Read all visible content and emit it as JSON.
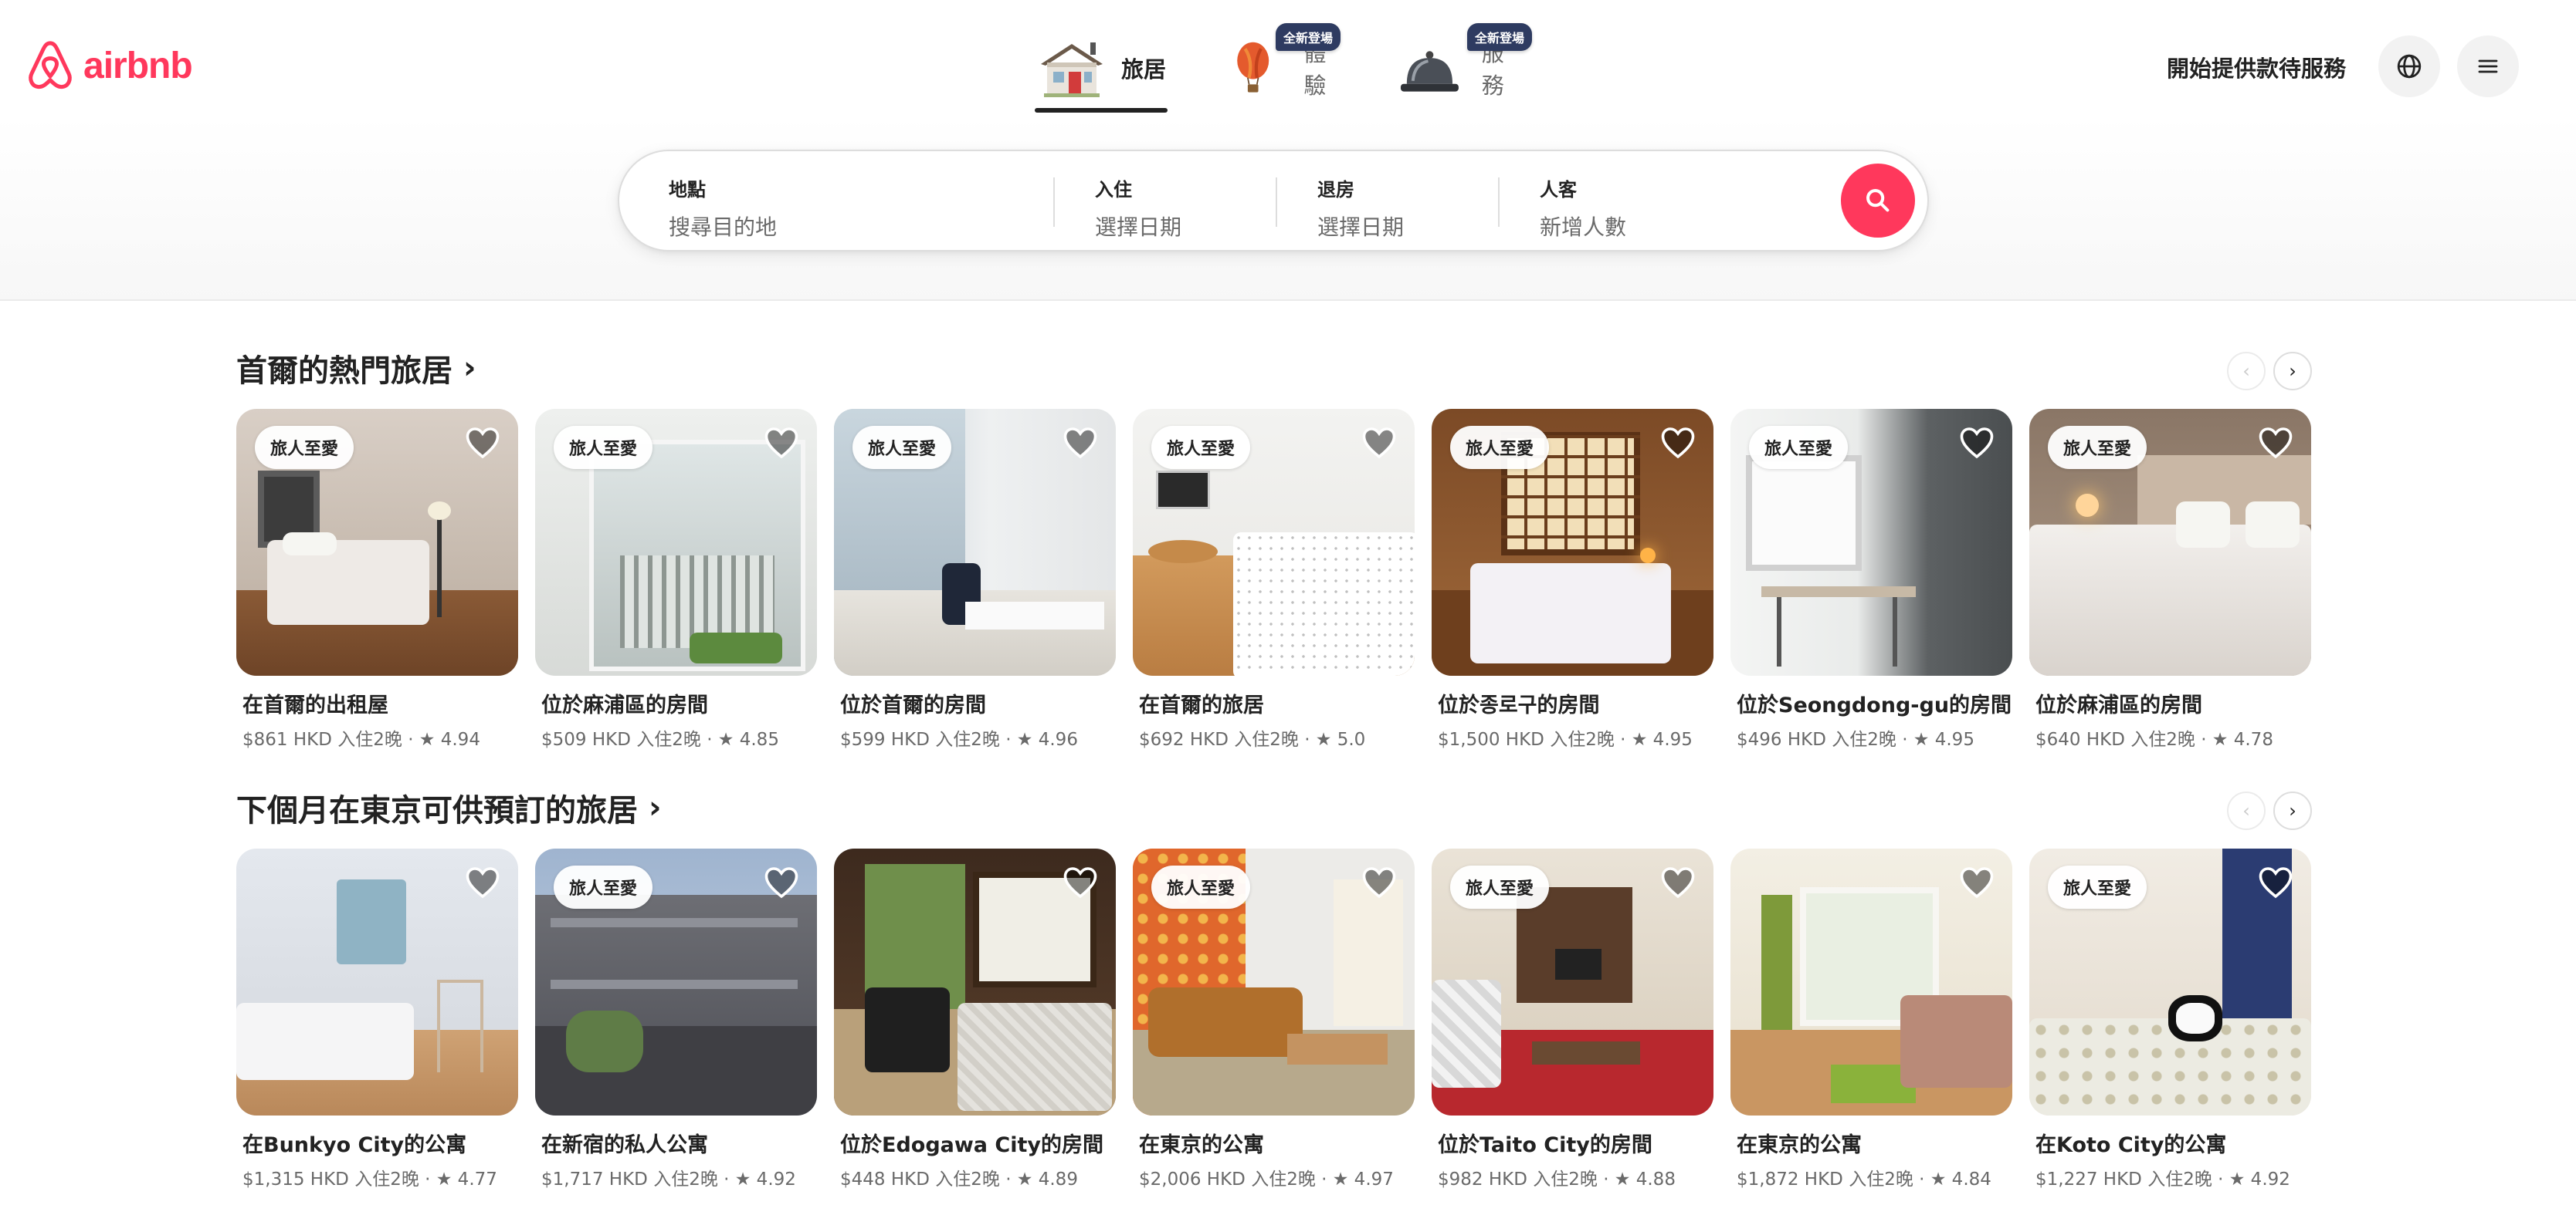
{
  "brand": {
    "name": "airbnb",
    "color": "#ff385c"
  },
  "nav": {
    "tabs": [
      {
        "label": "旅居",
        "icon": "house-icon",
        "active": true
      },
      {
        "label": "體驗",
        "icon": "hot-air-balloon-icon",
        "badge": "全新登場"
      },
      {
        "label": "服務",
        "icon": "service-bell-icon",
        "badge": "全新登場"
      }
    ],
    "host_link": "開始提供款待服務",
    "globe_icon": "globe-icon",
    "menu_icon": "hamburger-menu-icon"
  },
  "search": {
    "where": {
      "label": "地點",
      "placeholder": "搜尋目的地"
    },
    "checkin": {
      "label": "入住",
      "placeholder": "選擇日期"
    },
    "checkout": {
      "label": "退房",
      "placeholder": "選擇日期"
    },
    "guests": {
      "label": "人客",
      "placeholder": "新增人數"
    },
    "button_icon": "search-icon"
  },
  "sections": [
    {
      "title": "首爾的熱門旅居",
      "chevron": "›",
      "prev": "‹",
      "next": "›",
      "listings": [
        {
          "badge": "旅人至愛",
          "title": "在首爾的出租屋",
          "meta": "$861 HKD 入住2晚 · ★ 4.94"
        },
        {
          "badge": "旅人至愛",
          "title": "位於麻浦區的房間",
          "meta": "$509 HKD 入住2晚 · ★ 4.85"
        },
        {
          "badge": "旅人至愛",
          "title": "位於首爾的房間",
          "meta": "$599 HKD 入住2晚 · ★ 4.96"
        },
        {
          "badge": "旅人至愛",
          "title": "在首爾的旅居",
          "meta": "$692 HKD 入住2晚 · ★ 5.0"
        },
        {
          "badge": "旅人至愛",
          "title": "位於종로구的房間",
          "meta": "$1,500 HKD 入住2晚 · ★ 4.95"
        },
        {
          "badge": "旅人至愛",
          "title": "位於Seongdong-gu的房間",
          "meta": "$496 HKD 入住2晚 · ★ 4.95"
        },
        {
          "badge": "旅人至愛",
          "title": "位於麻浦區的房間",
          "meta": "$640 HKD 入住2晚 · ★ 4.78"
        }
      ]
    },
    {
      "title": "下個月在東京可供預訂的旅居",
      "chevron": "›",
      "prev": "‹",
      "next": "›",
      "listings": [
        {
          "badge": "",
          "title": "在Bunkyo City的公寓",
          "meta": "$1,315 HKD 入住2晚 · ★ 4.77"
        },
        {
          "badge": "旅人至愛",
          "title": "在新宿的私人公寓",
          "meta": "$1,717 HKD 入住2晚 · ★ 4.92"
        },
        {
          "badge": "",
          "title": "位於Edogawa City的房間",
          "meta": "$448 HKD 入住2晚 · ★ 4.89"
        },
        {
          "badge": "旅人至愛",
          "title": "在東京的公寓",
          "meta": "$2,006 HKD 入住2晚 · ★ 4.97"
        },
        {
          "badge": "旅人至愛",
          "title": "位於Taito City的房間",
          "meta": "$982 HKD 入住2晚 · ★ 4.88"
        },
        {
          "badge": "",
          "title": "在東京的公寓",
          "meta": "$1,872 HKD 入住2晚 · ★ 4.84"
        },
        {
          "badge": "旅人至愛",
          "title": "在Koto City的公寓",
          "meta": "$1,227 HKD 入住2晚 · ★ 4.92"
        }
      ]
    }
  ]
}
